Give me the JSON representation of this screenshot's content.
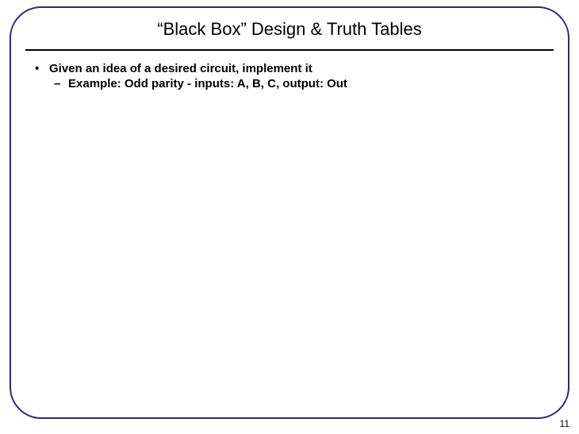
{
  "slide": {
    "title": "“Black Box” Design & Truth Tables",
    "bullets": {
      "level1_marker": "•",
      "level1_text": "Given an idea of a desired circuit, implement it",
      "level2_marker": "–",
      "level2_text": "Example:  Odd parity - inputs: A, B, C,  output: Out"
    },
    "page_number": "11"
  }
}
